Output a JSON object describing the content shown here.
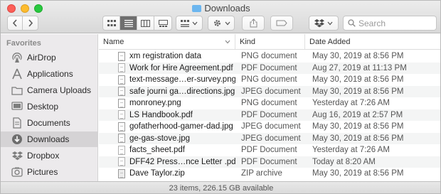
{
  "window": {
    "title": "Downloads"
  },
  "toolbar": {
    "search_placeholder": "Search"
  },
  "sidebar": {
    "heading": "Favorites",
    "items": [
      {
        "label": "AirDrop",
        "icon": "airdrop-icon"
      },
      {
        "label": "Applications",
        "icon": "applications-icon"
      },
      {
        "label": "Camera Uploads",
        "icon": "folder-icon"
      },
      {
        "label": "Desktop",
        "icon": "desktop-icon"
      },
      {
        "label": "Documents",
        "icon": "documents-icon"
      },
      {
        "label": "Downloads",
        "icon": "downloads-icon",
        "selected": true
      },
      {
        "label": "Dropbox",
        "icon": "dropbox-icon"
      },
      {
        "label": "Pictures",
        "icon": "pictures-icon"
      }
    ]
  },
  "list": {
    "columns": {
      "name": "Name",
      "kind": "Kind",
      "date": "Date Added"
    },
    "rows": [
      {
        "name": "xm registration data",
        "kind": "PNG document",
        "date": "May 30, 2019 at 8:56 PM"
      },
      {
        "name": "Work for Hire Agreement.pdf",
        "kind": "PDF Document",
        "date": "Aug 27, 2019 at 11:13 PM"
      },
      {
        "name": "text-message…er-survey.png",
        "kind": "PNG document",
        "date": "May 30, 2019 at 8:56 PM"
      },
      {
        "name": "safe journi ga…directions.jpg",
        "kind": "JPEG document",
        "date": "May 30, 2019 at 8:56 PM"
      },
      {
        "name": "monroney.png",
        "kind": "PNG document",
        "date": "Yesterday at 7:26 AM"
      },
      {
        "name": "LS Handbook.pdf",
        "kind": "PDF Document",
        "date": "Aug 16, 2019 at 2:57 PM"
      },
      {
        "name": "gofatherhood-gamer-dad.jpg",
        "kind": "JPEG document",
        "date": "May 30, 2019 at 8:56 PM"
      },
      {
        "name": "ge-gas-stove.jpg",
        "kind": "JPEG document",
        "date": "May 30, 2019 at 8:56 PM"
      },
      {
        "name": "facts_sheet.pdf",
        "kind": "PDF Document",
        "date": "Yesterday at 7:26 AM"
      },
      {
        "name": "DFF42 Press…nce Letter .pdf",
        "kind": "PDF Document",
        "date": "Today at 8:20 AM"
      },
      {
        "name": "Dave Taylor.zip",
        "kind": "ZIP archive",
        "date": "May 30, 2019 at 8:56 PM"
      }
    ]
  },
  "status": {
    "text": "23 items, 226.15 GB available"
  }
}
